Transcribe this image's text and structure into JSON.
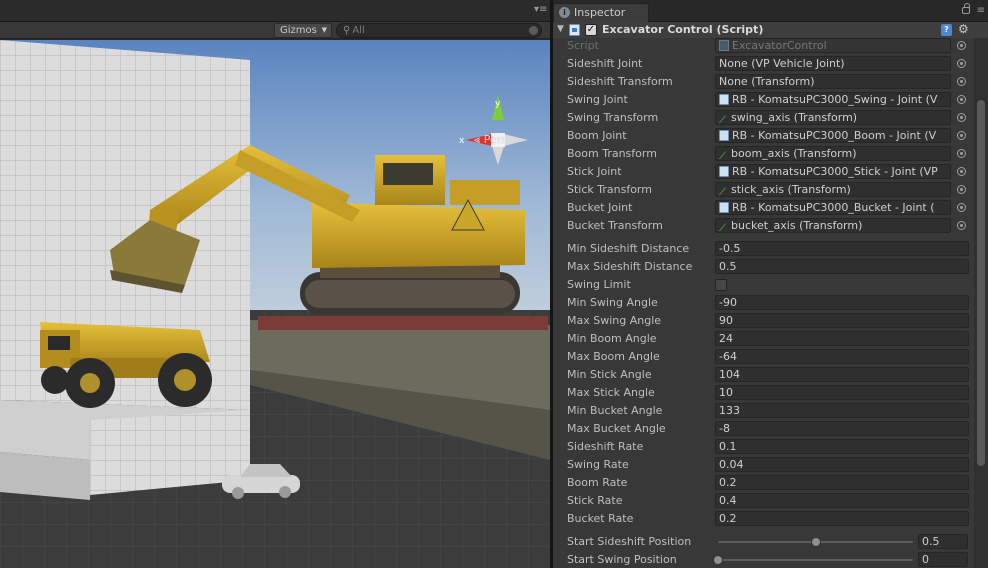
{
  "scene": {
    "gizmos_label": "Gizmos",
    "search_placeholder": "All",
    "persp_label": "Persp"
  },
  "inspector": {
    "tab_label": "Inspector",
    "component_title": "Excavator Control (Script)",
    "enabled": true,
    "rows": [
      {
        "label": "Script",
        "value": "ExcavatorControl",
        "kind": "obj",
        "icon": "script-file-icon",
        "dim": true
      },
      {
        "label": "Sideshift Joint",
        "value": "None (VP Vehicle Joint)",
        "kind": "obj",
        "icon": ""
      },
      {
        "label": "Sideshift Transform",
        "value": "None (Transform)",
        "kind": "obj",
        "icon": ""
      },
      {
        "label": "Swing Joint",
        "value": "RB - KomatsuPC3000_Swing - Joint (V",
        "kind": "obj",
        "icon": "rigidbody-icon"
      },
      {
        "label": "Swing Transform",
        "value": "swing_axis (Transform)",
        "kind": "obj",
        "icon": "transform-icon"
      },
      {
        "label": "Boom Joint",
        "value": "RB - KomatsuPC3000_Boom - Joint (V",
        "kind": "obj",
        "icon": "rigidbody-icon"
      },
      {
        "label": "Boom Transform",
        "value": "boom_axis (Transform)",
        "kind": "obj",
        "icon": "transform-icon"
      },
      {
        "label": "Stick Joint",
        "value": "RB - KomatsuPC3000_Stick - Joint (VP",
        "kind": "obj",
        "icon": "rigidbody-icon"
      },
      {
        "label": "Stick Transform",
        "value": "stick_axis (Transform)",
        "kind": "obj",
        "icon": "transform-icon"
      },
      {
        "label": "Bucket Joint",
        "value": "RB - KomatsuPC3000_Bucket - Joint (",
        "kind": "obj",
        "icon": "rigidbody-icon"
      },
      {
        "label": "Bucket Transform",
        "value": "bucket_axis (Transform)",
        "kind": "obj",
        "icon": "transform-icon"
      },
      {
        "label": "Min Sideshift Distance",
        "value": "-0.5",
        "kind": "num"
      },
      {
        "label": "Max Sideshift Distance",
        "value": "0.5",
        "kind": "num"
      },
      {
        "label": "Swing Limit",
        "value": "",
        "kind": "check",
        "checked": false
      },
      {
        "label": "Min Swing Angle",
        "value": "-90",
        "kind": "num"
      },
      {
        "label": "Max Swing Angle",
        "value": "90",
        "kind": "num"
      },
      {
        "label": "Min Boom Angle",
        "value": "24",
        "kind": "num"
      },
      {
        "label": "Max Boom Angle",
        "value": "-64",
        "kind": "num"
      },
      {
        "label": "Min Stick Angle",
        "value": "104",
        "kind": "num"
      },
      {
        "label": "Max Stick Angle",
        "value": "10",
        "kind": "num"
      },
      {
        "label": "Min Bucket Angle",
        "value": "133",
        "kind": "num"
      },
      {
        "label": "Max Bucket Angle",
        "value": "-8",
        "kind": "num"
      },
      {
        "label": "Sideshift Rate",
        "value": "0.1",
        "kind": "num"
      },
      {
        "label": "Swing Rate",
        "value": "0.04",
        "kind": "num"
      },
      {
        "label": "Boom Rate",
        "value": "0.2",
        "kind": "num"
      },
      {
        "label": "Stick Rate",
        "value": "0.4",
        "kind": "num"
      },
      {
        "label": "Bucket Rate",
        "value": "0.2",
        "kind": "num"
      },
      {
        "label": "Start Sideshift Position",
        "value": "0.5",
        "kind": "slider",
        "fraction": 0.5
      },
      {
        "label": "Start Swing Position",
        "value": "0",
        "kind": "slider",
        "fraction": 0.0
      }
    ]
  }
}
